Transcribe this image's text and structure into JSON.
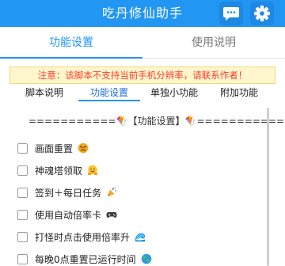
{
  "header": {
    "title": "吃丹修仙助手",
    "chat_icon": "chat-bubble-icon",
    "settings_icon": "gear-icon",
    "color": "#2196f3"
  },
  "top_tabs": [
    {
      "label": "功能设置",
      "active": true
    },
    {
      "label": "使用说明",
      "active": false
    }
  ],
  "notice": "注意：该脚本不支持当前手机分辨率，请联系作者！",
  "sub_tabs": [
    {
      "label": "脚本说明",
      "active": false
    },
    {
      "label": "功能设置",
      "active": true
    },
    {
      "label": "单独小功能",
      "active": false
    },
    {
      "label": "附加功能",
      "active": false
    }
  ],
  "section_title": "===========🪁【功能设置】🪁===========",
  "options": [
    {
      "label": "画面重置",
      "checked": false,
      "icon": "angry-face-icon"
    },
    {
      "label": "神魂塔领取",
      "checked": false,
      "icon": "hugging-face-icon"
    },
    {
      "label": "签到＋每日任务",
      "checked": false,
      "icon": "party-popper-icon"
    },
    {
      "label": "使用自动倍率卡",
      "checked": false,
      "icon": "game-controller-icon"
    },
    {
      "label": "打怪时点击使用倍率升",
      "checked": false,
      "icon": "wave-icon"
    },
    {
      "label": "每晚0点重置已运行时间",
      "checked": false,
      "icon": "globe-icon"
    }
  ]
}
